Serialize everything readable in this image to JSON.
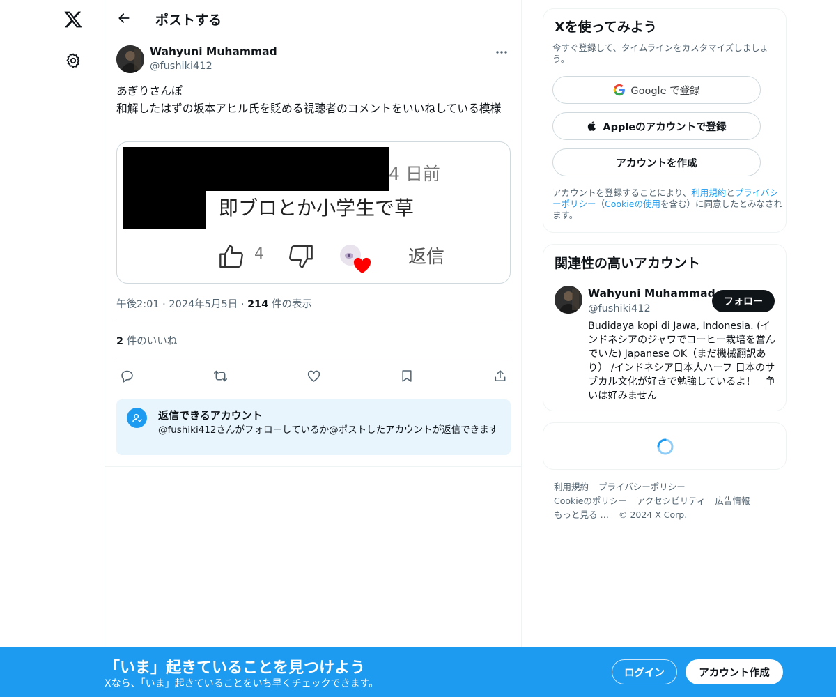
{
  "nav": {
    "logo_icon": "x-logo-icon",
    "settings_icon": "gear-icon"
  },
  "header": {
    "title": "ポストする",
    "back_icon": "arrow-left-icon"
  },
  "post": {
    "author_name": "Wahyuni Muhammad",
    "author_handle": "@fushiki412",
    "text": "あぎりさんぽ\n和解したはずの坂本アヒル氏を貶める視聴者のコメントをいいねしている模様",
    "media": {
      "time_ago": "4 日前",
      "comment": "即ブロとか小学生で草",
      "like_count": "4",
      "reply_label": "返信"
    },
    "time": "午後2:01",
    "date": "2024年5月5日",
    "views_count": "214",
    "views_label": "件の表示",
    "likes_count": "2",
    "likes_label": "件のいいね",
    "action_icons": [
      "reply-icon",
      "repost-icon",
      "like-icon",
      "bookmark-icon",
      "share-icon"
    ]
  },
  "reply_restriction": {
    "title": "返信できるアカウント",
    "description": "@fushiki412さんがフォローしているか@ポストしたアカウントが返信できます"
  },
  "signup_card": {
    "title": "Xを使ってみよう",
    "subtitle": "今すぐ登録して、タイムラインをカスタマイズしましょう。",
    "google_label": "Google で登録",
    "apple_label": "Appleのアカウントで登録",
    "create_label": "アカウントを作成",
    "terms_prefix": "アカウントを登録することにより、",
    "terms_link": "利用規約",
    "terms_and": "と",
    "privacy_link": "プライバシーポリシー",
    "paren_open": "（",
    "cookie_link": "Cookieの使用",
    "terms_suffix": "を含む）に同意したとみなされます。"
  },
  "relevant_card": {
    "title": "関連性の高いアカウント",
    "name": "Wahyuni Muhammad",
    "handle": "@fushiki412",
    "follow_label": "フォロー",
    "bio": "Budidaya kopi di Jawa, Indonesia. (インドネシアのジャワでコーヒー栽培を営んでいた) Japanese OK（まだ機械翻訳あり） /インドネシア日本人ハーフ 日本のサブカル文化が好きで勉強しているよ！　争いは好みません"
  },
  "footer": {
    "links": [
      "利用規約",
      "プライバシーポリシー",
      "Cookieのポリシー",
      "アクセシビリティ",
      "広告情報",
      "もっと見る …"
    ],
    "copyright": "© 2024 X Corp."
  },
  "bottom_bar": {
    "title": "「いま」起きていることを見つけよう",
    "subtitle": "Xなら、「いま」起きていることをいち早くチェックできます。",
    "login_label": "ログイン",
    "signup_label": "アカウント作成"
  },
  "colors": {
    "accent": "#1d9bf0",
    "text": "#0f1419",
    "muted": "#536471",
    "border": "#eff3f4"
  }
}
